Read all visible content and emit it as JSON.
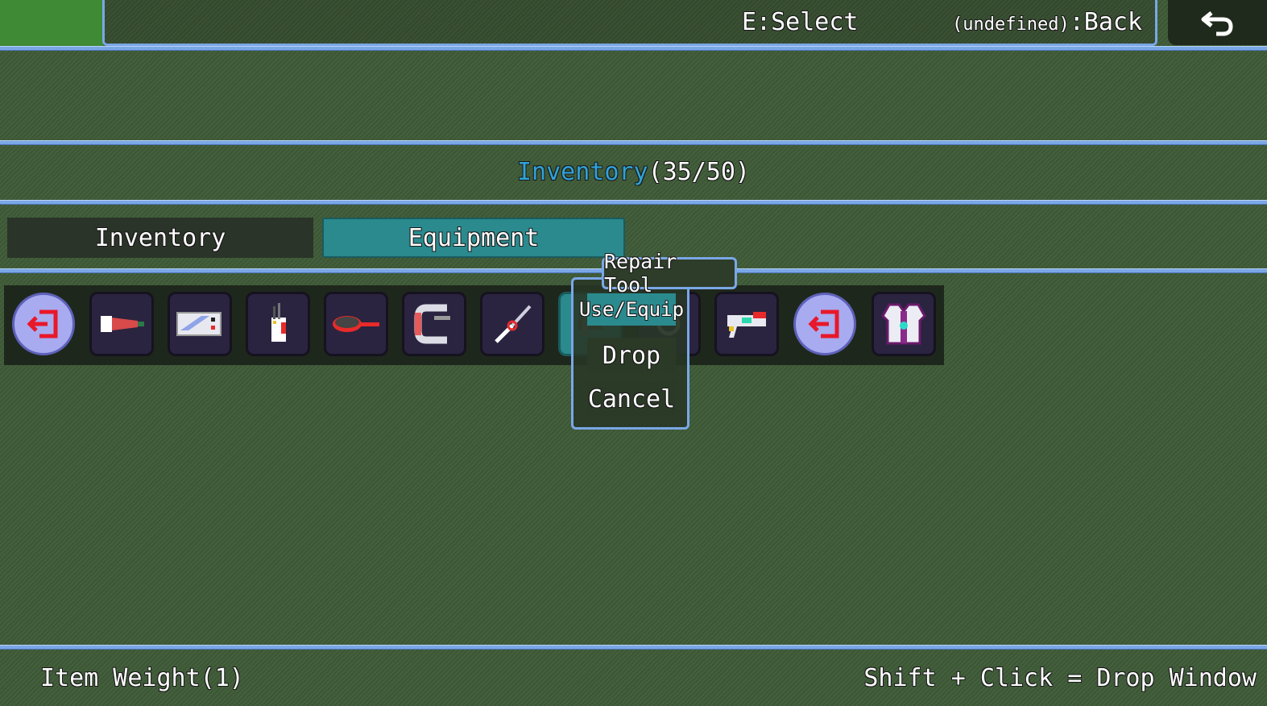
{
  "top_bar": {
    "select_hint": "E:Select",
    "back_key": "(undefined)",
    "back_hint": ":Back"
  },
  "inventory_header": {
    "label": "Inventory",
    "count": "(35/50)"
  },
  "tabs": [
    {
      "label": "Inventory",
      "active": false
    },
    {
      "label": "Equipment",
      "active": true
    }
  ],
  "slots": [
    {
      "icon": "unequip-icon"
    },
    {
      "icon": "flashlight-icon"
    },
    {
      "icon": "battery-icon"
    },
    {
      "icon": "tool-pouch-icon"
    },
    {
      "icon": "frying-pan-icon"
    },
    {
      "icon": "c-clamp-icon"
    },
    {
      "icon": "knife-icon"
    },
    {
      "icon": "repair-tool-icon",
      "selected": true
    },
    {
      "icon": "repair-tool-icon"
    },
    {
      "icon": "blaster-icon"
    },
    {
      "icon": "unequip-icon"
    },
    {
      "icon": "armor-vest-icon"
    }
  ],
  "tooltip": {
    "item_name": "Repair Tool"
  },
  "context_menu": {
    "use_equip": "Use/Equip",
    "drop": "Drop",
    "cancel": "Cancel"
  },
  "footer": {
    "item_weight": "Item Weight(1)",
    "drop_hint": "Shift + Click = Drop Window"
  },
  "colors": {
    "accent_border": "#7aa7e6",
    "selected_tab": "#2a8a8e",
    "highlight_text": "#2fa3d9"
  }
}
